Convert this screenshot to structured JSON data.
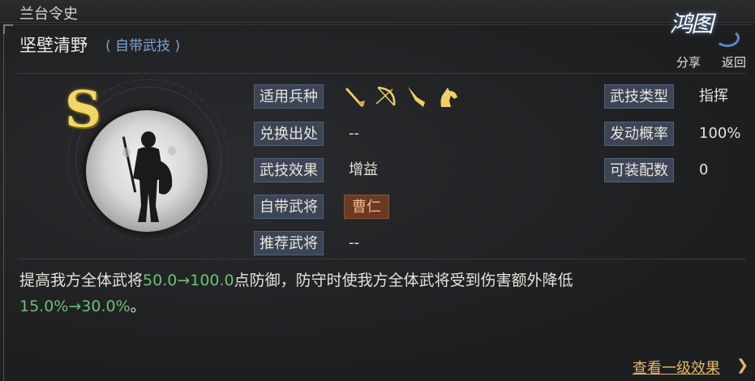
{
  "header": {
    "title": "兰台令史"
  },
  "skill": {
    "name": "坚壁清野",
    "sub": "( 自带武技 )",
    "grade": "S"
  },
  "top_buttons": {
    "share": "分享",
    "back": "返回"
  },
  "fields_left": [
    {
      "label": "适用兵种",
      "value": ""
    },
    {
      "label": "兑换出处",
      "value": "--"
    },
    {
      "label": "武技效果",
      "value": "增益"
    },
    {
      "label": "自带武将",
      "value": "曹仁"
    },
    {
      "label": "推荐武将",
      "value": "--"
    }
  ],
  "fields_right": [
    {
      "label": "武技类型",
      "value": "指挥"
    },
    {
      "label": "发动概率",
      "value": "100%"
    },
    {
      "label": "可装配数",
      "value": "0"
    }
  ],
  "unit_icons": [
    "spear-icon",
    "bow-icon",
    "blade-icon",
    "horse-icon"
  ],
  "description": {
    "p1": "提高我方全体武将",
    "v1": "50.0→100.0",
    "p2": "点防御，防守时使我方全体武将受到伤害额外降低",
    "v2": "15.0%→30.0%",
    "p3": "。"
  },
  "footer": {
    "link": "查看一级效果",
    "arrow": "❯"
  },
  "colors": {
    "accent_gold": "#e2b76a",
    "highlight_green": "#6cc070",
    "label_bg": "#3b4556",
    "sub_blue": "#7da3d0"
  }
}
